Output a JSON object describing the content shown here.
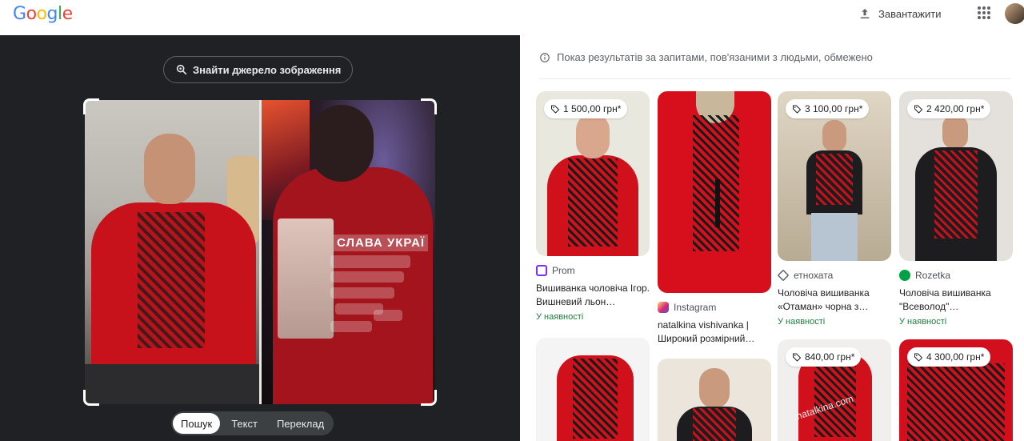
{
  "header": {
    "logo": "Google",
    "upload_label": "Завантажити"
  },
  "lens": {
    "find_source_label": "Знайти джерело зображення",
    "photo_overlay_text": "СЛАВА УКРАЇ",
    "modes": [
      "Пошук",
      "Текст",
      "Переклад"
    ],
    "active_mode": "Пошук"
  },
  "results": {
    "notice": "Показ результатів за запитами, пов'язаними з людьми, обмежено",
    "cards": [
      {
        "price": "1 500,00 грн*",
        "source": "Prom",
        "source_color": "#7b2ff7",
        "title": "Вишиванка чоловіча Ігор. Вишневий льон…",
        "stock": "У наявності"
      },
      {
        "price": "",
        "source": "Instagram",
        "source_color": "#e1306c",
        "title": "natalkina vishivanka | Широкий розмірний…",
        "stock": ""
      },
      {
        "price": "3 100,00 грн*",
        "source": "етнохата",
        "source_color": "#5f6368",
        "title": "Чоловіча вишиванка «Отаман» чорна з…",
        "stock": "У наявності"
      },
      {
        "price": "2 420,00 грн*",
        "source": "Rozetka",
        "source_color": "#00a046",
        "title": "Чоловіча вишиванка \"Всеволод\"…",
        "stock": "У наявності"
      },
      {
        "price": "",
        "source": "",
        "title": "",
        "stock": ""
      },
      {
        "price": "",
        "source": "",
        "title": "",
        "stock": ""
      },
      {
        "price": "840,00 грн*",
        "source": "",
        "title": "",
        "stock": "",
        "watermark": "natalkina.com"
      },
      {
        "price": "4 300,00 грн*",
        "source": "",
        "title": "",
        "stock": ""
      }
    ]
  }
}
